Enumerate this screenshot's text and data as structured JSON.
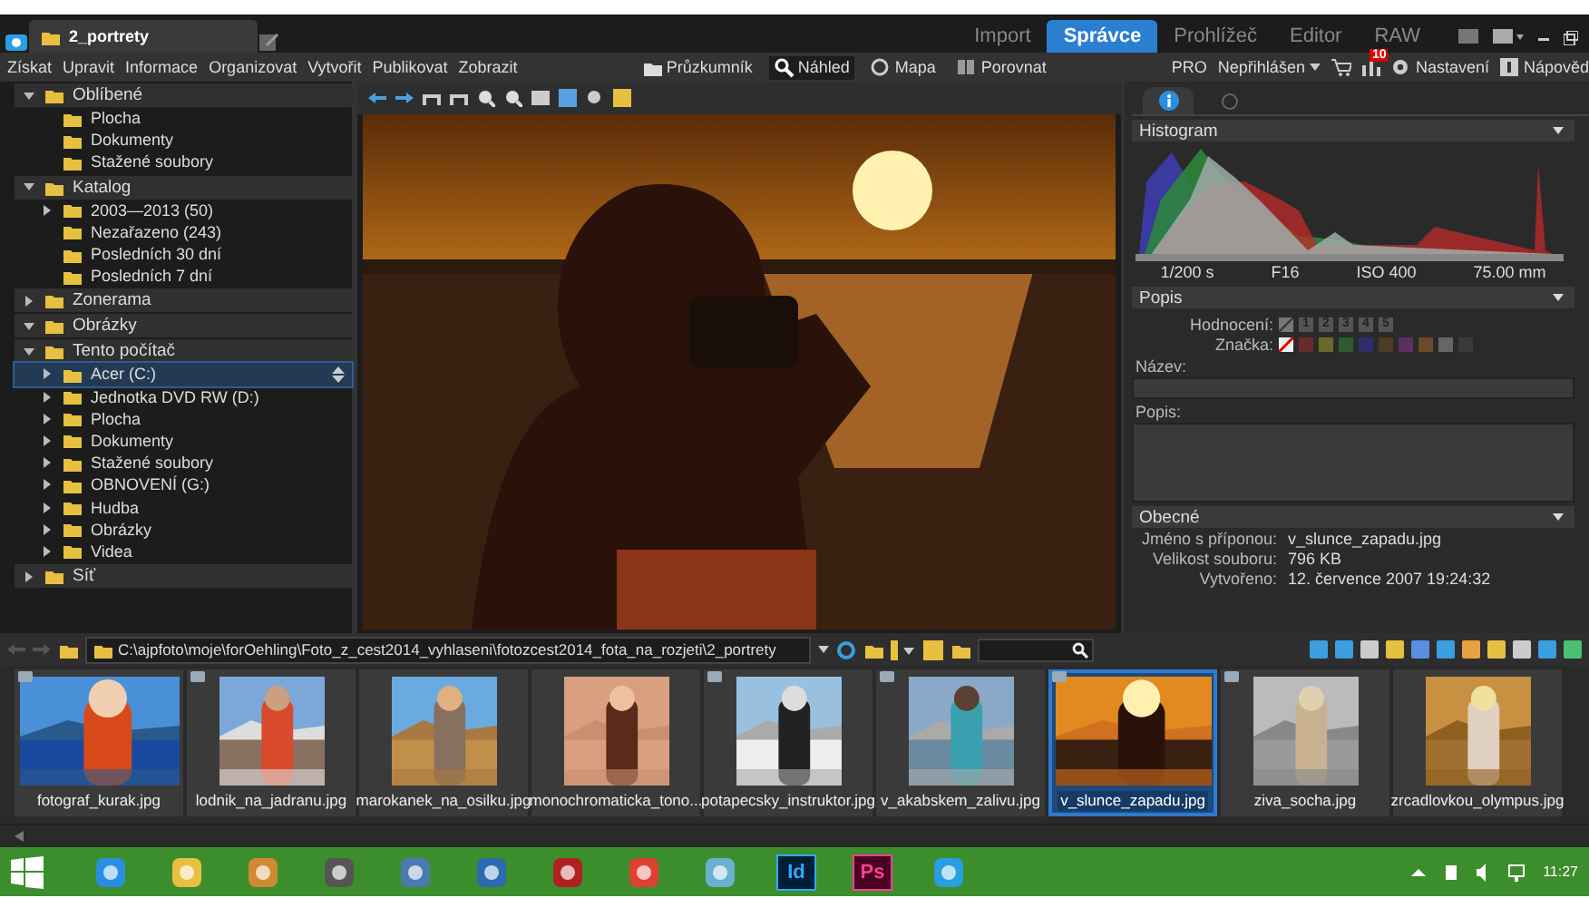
{
  "doc_tabs": [
    {
      "label": "2_portrety",
      "selected": true
    }
  ],
  "modes": [
    {
      "label": "Import",
      "selected": false
    },
    {
      "label": "Správce",
      "selected": true
    },
    {
      "label": "Prohlížeč",
      "selected": false
    },
    {
      "label": "Editor",
      "selected": false
    },
    {
      "label": "RAW",
      "selected": false
    }
  ],
  "menu": [
    "Získat",
    "Upravit",
    "Informace",
    "Organizovat",
    "Vytvořit",
    "Publikovat",
    "Zobrazit"
  ],
  "views": [
    {
      "label": "Průzkumník",
      "selected": false
    },
    {
      "label": "Náhled",
      "selected": true
    },
    {
      "label": "Mapa",
      "selected": false
    },
    {
      "label": "Porovnat",
      "selected": false
    }
  ],
  "account": {
    "edition": "PRO",
    "user": "Nepřihlášen",
    "notifications": "10",
    "settings": "Nastavení",
    "help": "Nápověd"
  },
  "tree": [
    {
      "label": "Oblíbené",
      "expanded": true,
      "children": [
        {
          "label": "Plocha",
          "expandable": false,
          "selected": false
        },
        {
          "label": "Dokumenty",
          "expandable": false,
          "selected": false
        },
        {
          "label": "Stažené soubory",
          "expandable": false,
          "selected": false
        }
      ]
    },
    {
      "label": "Katalog",
      "expanded": true,
      "children": [
        {
          "label": "2003—2013 (50)",
          "expandable": true,
          "selected": false
        },
        {
          "label": "Nezařazeno (243)",
          "expandable": false,
          "selected": false
        },
        {
          "label": "Posledních 30 dní",
          "expandable": false,
          "selected": false
        },
        {
          "label": "Posledních 7 dní",
          "expandable": false,
          "selected": false
        }
      ]
    },
    {
      "label": "Zonerama",
      "expanded": false
    },
    {
      "label": "Obrázky",
      "expanded": true
    },
    {
      "label": "Tento počítač",
      "expanded": true,
      "children": [
        {
          "label": "Acer (C:)",
          "expandable": true,
          "selected": true
        },
        {
          "label": "Jednotka DVD RW (D:)",
          "expandable": true,
          "selected": false
        },
        {
          "label": "Plocha",
          "expandable": true,
          "selected": false
        },
        {
          "label": "Dokumenty",
          "expandable": true,
          "selected": false
        },
        {
          "label": "Stažené soubory",
          "expandable": true,
          "selected": false
        },
        {
          "label": "OBNOVENÍ (G:)",
          "expandable": true,
          "selected": false
        },
        {
          "label": "Hudba",
          "expandable": true,
          "selected": false
        },
        {
          "label": "Obrázky",
          "expandable": true,
          "selected": false
        },
        {
          "label": "Videa",
          "expandable": true,
          "selected": false
        }
      ]
    },
    {
      "label": "Síť",
      "expanded": false
    }
  ],
  "info": {
    "histogram": {
      "title": "Histogram",
      "exif": [
        "1/200 s",
        "F16",
        "ISO 400",
        "75.00 mm"
      ]
    },
    "description": {
      "title": "Popis",
      "rating_label": "Hodnocení:",
      "rating": [
        "1",
        "2",
        "3",
        "4",
        "5"
      ],
      "label_label": "Značka:",
      "labels": [
        {
          "color": "#6a2a2a"
        },
        {
          "color": "#6a6a2a"
        },
        {
          "color": "#2f5a2f"
        },
        {
          "color": "#2e2e6e"
        },
        {
          "color": "#4e3a28"
        },
        {
          "color": "#5e2e62"
        },
        {
          "color": "#6a4a2a"
        },
        {
          "color": "#666666"
        },
        {
          "color": "#3a3a3a"
        }
      ],
      "name_label": "Název:",
      "text_label": "Popis:"
    },
    "general": {
      "title": "Obecné",
      "rows": [
        {
          "label": "Jméno s příponou:",
          "value": "v_slunce_zapadu.jpg"
        },
        {
          "label": "Velikost souboru:",
          "value": "796 KB"
        },
        {
          "label": "Vytvořeno:",
          "value": "12. července 2007 19:24:32"
        }
      ]
    }
  },
  "path": "C:\\ajpfoto\\moje\\forOehling\\Foto_z_cest2014_vyhlaseni\\fotozcest2014_fota_na_rozjeti\\2_portrety",
  "thumbnails": [
    {
      "name": "fotograf_kurak.jpg",
      "selected": false
    },
    {
      "name": "lodnik_na_jadranu.jpg",
      "selected": false
    },
    {
      "name": "marokanek_na_osilku.jpg",
      "selected": false
    },
    {
      "name": "monochromaticka_tono...",
      "selected": false
    },
    {
      "name": "potapecsky_instruktor.jpg",
      "selected": false
    },
    {
      "name": "v_akabskem_zalivu.jpg",
      "selected": false
    },
    {
      "name": "v_slunce_zapadu.jpg",
      "selected": true
    },
    {
      "name": "ziva_socha.jpg",
      "selected": false
    },
    {
      "name": "zrcadlovkou_olympus.jpg",
      "selected": false
    }
  ],
  "taskbar": {
    "apps": [
      {
        "kind": "icon"
      },
      {
        "kind": "icon"
      },
      {
        "kind": "icon"
      },
      {
        "kind": "icon"
      },
      {
        "kind": "icon"
      },
      {
        "kind": "icon"
      },
      {
        "kind": "icon"
      },
      {
        "kind": "icon"
      },
      {
        "kind": "icon"
      },
      {
        "kind": "text",
        "label": "Id"
      },
      {
        "kind": "text",
        "label": "Ps"
      },
      {
        "kind": "icon"
      }
    ],
    "clock": "11:27"
  }
}
